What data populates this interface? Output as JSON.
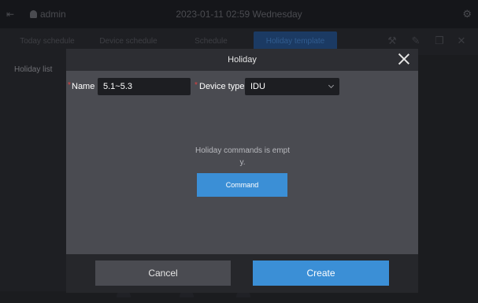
{
  "topbar": {
    "user": "admin",
    "datetime": "2023-01-11 02:59 Wednesday",
    "exit_icon": "exit-icon",
    "settings_icon": "gear-icon"
  },
  "tabs": [
    {
      "label": "Today schedule"
    },
    {
      "label": "Device schedule"
    },
    {
      "label": "Schedule"
    },
    {
      "label": "Holiday template"
    }
  ],
  "left_pane": {
    "title": "Holiday list"
  },
  "modal": {
    "title": "Holiday",
    "name_label": "Name",
    "name_value": "5.1~5.3",
    "device_type_label": "Device type",
    "device_type_value": "IDU",
    "empty_message_line1": "Holiday commands is empt",
    "empty_message_line2": "y.",
    "command_button": "Command",
    "cancel_button": "Cancel",
    "create_button": "Create"
  },
  "colors": {
    "accent": "#3b8fd6",
    "required": "#e04040",
    "modal_bg": "#4a4b51",
    "header_bg": "#2d2e33"
  }
}
